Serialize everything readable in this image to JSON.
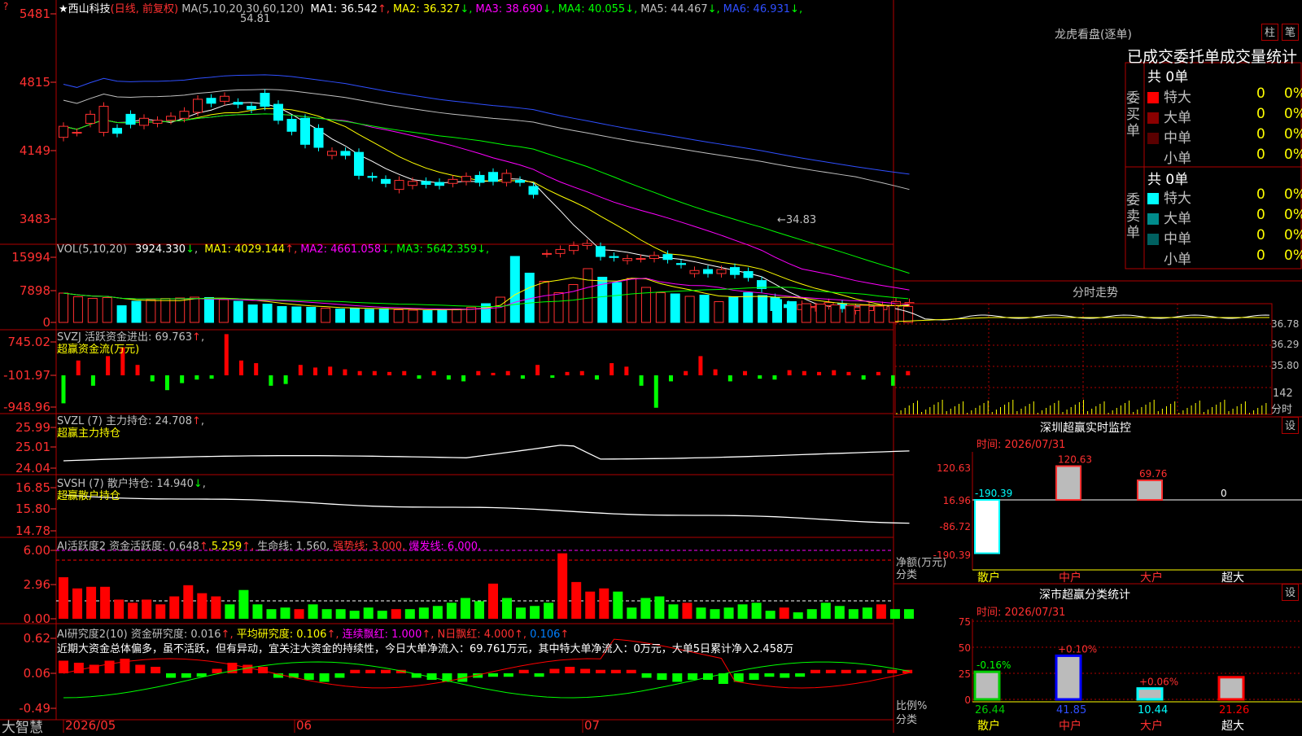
{
  "app": {
    "footer_logo": "大智慧",
    "corner_mark": "?"
  },
  "kline": {
    "stock_name": "西山科技",
    "period": "(日线, 前复权)",
    "ma_def": "MA(5,10,20,30,60,120)",
    "ma_items": [
      {
        "label": "MA1: 36.542",
        "arrow": "↑",
        "color": "#ffffff"
      },
      {
        "label": "MA2: 36.327",
        "arrow": "↓",
        "color": "#ffff00"
      },
      {
        "label": "MA3: 38.690",
        "arrow": "↓",
        "color": "#ff00ff"
      },
      {
        "label": "MA4: 40.055",
        "arrow": "↓",
        "color": "#00ff00"
      },
      {
        "label": "MA5: 44.467",
        "arrow": "↓",
        "color": "#c0c0c0"
      },
      {
        "label": "MA6: 46.931",
        "arrow": "↓",
        "color": "#2f4fff"
      }
    ],
    "y_ticks": [
      "5481",
      "4815",
      "4149",
      "3483"
    ],
    "high_label": "54.81",
    "low_label": "←34.83"
  },
  "vol": {
    "title": "VOL(5,10,20)",
    "value": "3924.330",
    "value_arrow": "↓",
    "items": [
      {
        "label": "MA1: 4029.144",
        "arrow": "↑",
        "color": "#ffff00"
      },
      {
        "label": "MA2: 4661.058",
        "arrow": "↓",
        "color": "#ff00ff"
      },
      {
        "label": "MA3: 5642.359",
        "arrow": "↓",
        "color": "#00ff00"
      }
    ],
    "y_ticks": [
      "15994",
      "7898",
      "0"
    ]
  },
  "svzj": {
    "title": "SVZJ  活跃资金进出: 69.763",
    "arrow": "↑",
    "sub": "超赢资金流(万元)",
    "y_ticks": [
      "745.02",
      "-101.97",
      "-948.96"
    ]
  },
  "svzl": {
    "title": "SVZL (7) 主力持仓: 24.708",
    "arrow": "↑",
    "sub": "超赢主力持仓",
    "y_ticks": [
      "25.99",
      "25.01",
      "24.04"
    ]
  },
  "svsh": {
    "title": "SVSH (7) 散户持仓: 14.940",
    "arrow": "↓",
    "sub": "超赢散户持仓",
    "y_ticks": [
      "16.85",
      "15.80",
      "14.78"
    ]
  },
  "ai_act": {
    "title": "AI活跃度2 资金活跃度: 0.648",
    "v2": "5.259",
    "life": "生命线: 1.560",
    "strong": "强势线: 3.000",
    "burst": "爆发线: 6.000",
    "y_ticks": [
      "6.00",
      "2.96",
      "0.00"
    ]
  },
  "ai_res": {
    "title": "AI研究度2(10) 资金研究度: 0.016",
    "avg": "平均研究度: 0.106",
    "cont": "连续飘红: 1.000",
    "nday": "N日飘红: 4.000",
    "last": "0.106",
    "comment": "近期大资金总体偏多，虽不活跃，但有异动，宜关注大资金的持续性，今日大单净流入：69.761万元，其中特大单净流入：0万元，大单5日累计净入2.458万",
    "y_ticks": [
      "0.62",
      "0.06",
      "-0.49"
    ]
  },
  "x_axis": {
    "labels": [
      "2026/05",
      "06",
      "07"
    ]
  },
  "right": {
    "lhb_title": "龙虎看盘(逐单)",
    "btn_zhu": "柱",
    "btn_bi": "笔",
    "tabs": "已成交委托单成交量统计",
    "buy_side": "委买单",
    "sell_side": "委卖单",
    "buy_total": "共 0单",
    "sell_total": "共 0单",
    "buy_rows": [
      {
        "name": "特大",
        "n": "0",
        "pct": "0%",
        "color": "#ff0000"
      },
      {
        "name": "大单",
        "n": "0",
        "pct": "0%",
        "color": "#8b0000"
      },
      {
        "name": "中单",
        "n": "0",
        "pct": "0%",
        "color": "#5a0000"
      },
      {
        "name": "小单",
        "n": "0",
        "pct": "0%",
        "color": "#000000"
      }
    ],
    "sell_rows": [
      {
        "name": "特大",
        "n": "0",
        "pct": "0%",
        "color": "#00ffff"
      },
      {
        "name": "大单",
        "n": "0",
        "pct": "0%",
        "color": "#008b8b"
      },
      {
        "name": "中单",
        "n": "0",
        "pct": "0%",
        "color": "#006060"
      },
      {
        "name": "小单",
        "n": "0",
        "pct": "0%",
        "color": "#000000"
      }
    ],
    "fenshi_title": "分时走势",
    "fenshi_y": [
      "36.78",
      "36.29",
      "35.80"
    ],
    "fenshi_vol": "142",
    "fenshi_unit": "分时",
    "sz_title": "深圳超赢实时监控",
    "sz_time": "时间: 2026/07/31",
    "sz_btn": "设",
    "sz_y": [
      "120.63",
      "16.96",
      "-86.72",
      "-190.39"
    ],
    "sz_vals": [
      "-190.39",
      "120.63",
      "69.76",
      "0"
    ],
    "sz_unit": "净额(万元)",
    "sz_cat": "分类",
    "cats": [
      "散户",
      "中户",
      "大户",
      "超大"
    ],
    "cls_title": "深市超赢分类统计",
    "cls_time": "时间: 2026/07/31",
    "cls_btn": "设",
    "cls_y": [
      "75",
      "50",
      "25",
      "0"
    ],
    "cls_vals": [
      "26.44",
      "41.85",
      "10.44",
      "21.26"
    ],
    "cls_chg": [
      "-0.16%",
      "+0.10%",
      "+0.06%",
      ""
    ],
    "cls_unit": "比例%",
    "cls_cat": "分类"
  },
  "chart_data": [
    {
      "type": "candlestick",
      "title": "西山科技 (日线, 前复权)",
      "ylim": [
        34.0,
        55.3
      ],
      "open": [
        42.4,
        42.9,
        43.8,
        42.9,
        43.3,
        44.7,
        43.6,
        43.8,
        44.1,
        44.3,
        44.9,
        46.3,
        46.0,
        45.9,
        45.5,
        46.8,
        45.7,
        44.2,
        44.3,
        43.3,
        40.6,
        41.0,
        40.9,
        38.5,
        38.2,
        37.2,
        37.6,
        38.0,
        37.9,
        37.8,
        38.0,
        38.6,
        38.9,
        37.9,
        38.1,
        37.5,
        30.8,
        30.8,
        31.1,
        31.6,
        31.5,
        30.5,
        30.1,
        30.3,
        30.3,
        30.7,
        29.8,
        28.8,
        29.2,
        28.8,
        29.4,
        29.0,
        28.1,
        26.4,
        25.7,
        25.2,
        25.4,
        25.6,
        25.8,
        25.1,
        25.1,
        25.2,
        25.6,
        25.8
      ],
      "close": [
        43.5,
        42.9,
        44.7,
        45.5,
        42.8,
        43.7,
        44.3,
        44.1,
        44.5,
        45.0,
        46.2,
        45.8,
        46.5,
        45.7,
        45.2,
        45.5,
        44.1,
        43.0,
        41.7,
        41.4,
        41.0,
        40.6,
        38.6,
        38.4,
        37.8,
        38.1,
        38.0,
        37.7,
        37.6,
        38.2,
        38.5,
        37.9,
        38.0,
        38.8,
        37.9,
        36.7,
        30.8,
        31.2,
        31.6,
        31.8,
        30.5,
        30.4,
        30.3,
        30.3,
        30.6,
        30.2,
        29.7,
        29.1,
        28.8,
        29.2,
        28.7,
        28.4,
        27.3,
        25.1,
        25.4,
        25.7,
        25.5,
        25.9,
        25.3,
        25.4,
        25.5,
        25.6,
        26.0,
        25.9
      ],
      "annotations": [
        "54.81",
        "←34.83"
      ]
    },
    {
      "type": "bar",
      "title": "VOL(5,10,20)",
      "ylim": [
        0,
        15994
      ],
      "values": [
        7200,
        6300,
        5900,
        6100,
        4100,
        5200,
        5600,
        5900,
        6000,
        6200,
        6100,
        5600,
        5200,
        4300,
        4500,
        3900,
        3800,
        3700,
        3500,
        3300,
        3500,
        3200,
        3400,
        3100,
        3000,
        2900,
        3200,
        3300,
        3700,
        4600,
        6200,
        16200,
        12100,
        10100,
        7300,
        9300,
        13200,
        11100,
        9800,
        10800,
        8600,
        7300,
        7000,
        6400,
        6700,
        5100,
        6300,
        7300,
        6600,
        5600,
        5100,
        4600,
        4500,
        4300,
        4100,
        4200,
        4000,
        4100,
        3924
      ]
    }
  ]
}
